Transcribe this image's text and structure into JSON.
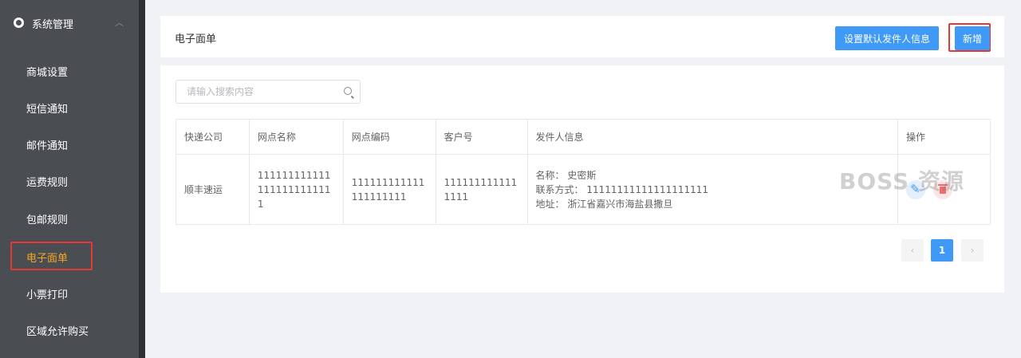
{
  "sidebar": {
    "group_label": "系统管理",
    "items": [
      {
        "label": "商城设置"
      },
      {
        "label": "短信通知"
      },
      {
        "label": "邮件通知"
      },
      {
        "label": "运费规则"
      },
      {
        "label": "包邮规则"
      },
      {
        "label": "电子面单"
      },
      {
        "label": "小票打印"
      },
      {
        "label": "区域允许购买"
      }
    ],
    "active_index": 5
  },
  "header": {
    "title": "电子面单",
    "default_sender_button": "设置默认发件人信息",
    "new_button": "新增"
  },
  "search": {
    "placeholder": "请输入搜索内容",
    "value": ""
  },
  "table": {
    "columns": [
      "快递公司",
      "网点名称",
      "网点编码",
      "客户号",
      "发件人信息",
      "操作"
    ],
    "rows": [
      {
        "company": "顺丰速运",
        "outlet_name": "1111111111111111111111111",
        "outlet_code": "111111111111111111111",
        "customer_no": "1111111111111111",
        "sender_name": "名称：  史密斯",
        "sender_contact": "联系方式：  11111111111111111111",
        "sender_address": "地址：  浙江省嘉兴市海盐县撒旦"
      }
    ]
  },
  "pagination": {
    "prev": "‹",
    "current_page": "1",
    "next": "›"
  },
  "watermark": "BOSS 资源"
}
